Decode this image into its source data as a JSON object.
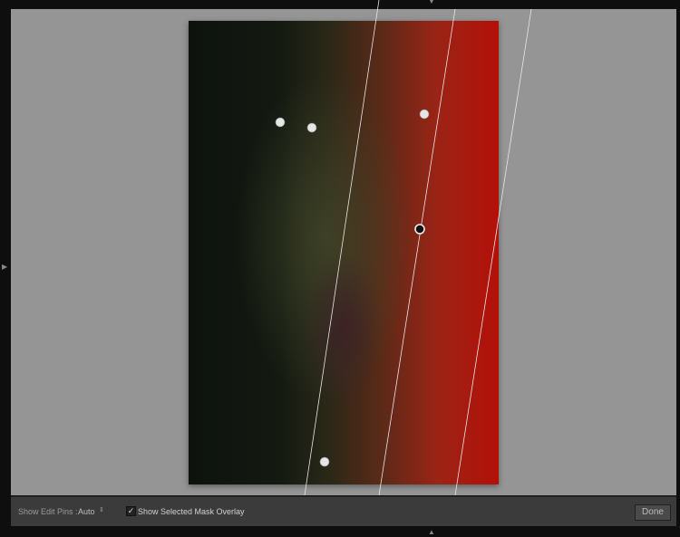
{
  "toolbar": {
    "show_edit_pins_label": "Show Edit Pins :",
    "show_edit_pins_value": "Auto",
    "show_mask_overlay_label": "Show Selected Mask Overlay",
    "show_mask_overlay_checked": true,
    "done_label": "Done"
  },
  "colors": {
    "mask_overlay": "#c00000",
    "background": "#959595"
  },
  "icons": {
    "stepper": "up-down-stepper-icon",
    "check": "checkmark-icon",
    "panel_toggle": "triangle-icon"
  }
}
